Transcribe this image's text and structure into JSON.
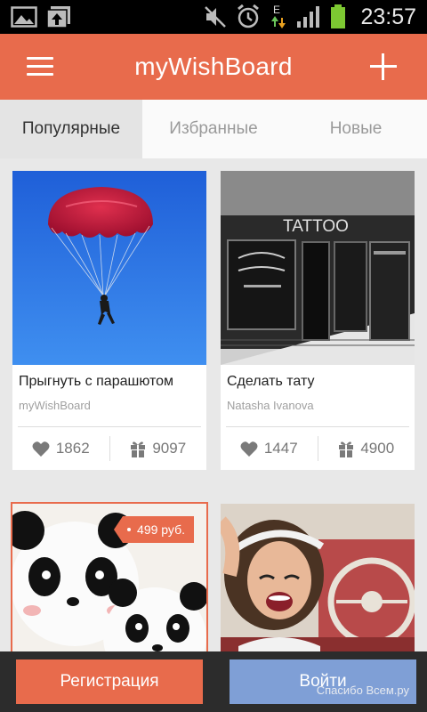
{
  "status_bar": {
    "time": "23:57",
    "network_label": "E",
    "icons": [
      "gallery-icon",
      "media-upload-icon",
      "mute-icon",
      "alarm-icon",
      "data-arrows-icon",
      "signal-icon",
      "battery-icon"
    ]
  },
  "app_bar": {
    "title": "myWishBoard",
    "menu_icon": "hamburger-menu-icon",
    "add_icon": "plus-icon",
    "background": "#e86b4c"
  },
  "tabs": [
    {
      "label": "Популярные",
      "active": true
    },
    {
      "label": "Избранные",
      "active": false
    },
    {
      "label": "Новые",
      "active": false
    }
  ],
  "cards": [
    {
      "title": "Прыгнуть с парашютом",
      "author": "myWishBoard",
      "likes": "1862",
      "gifts": "9097",
      "image": "parachute-photo"
    },
    {
      "title": "Сделать тату",
      "author": "Natasha Ivanova",
      "likes": "1447",
      "gifts": "4900",
      "image": "tattoo-shop-photo",
      "sign_text": "TATTOO"
    },
    {
      "title": "",
      "author": "",
      "price": "499 руб.",
      "image": "panda-plush-photo"
    },
    {
      "title": "",
      "author": "",
      "image": "woman-in-car-photo"
    }
  ],
  "bottom_bar": {
    "register_label": "Регистрация",
    "login_label": "Войти",
    "watermark": "Спасибо Всем.ру"
  },
  "colors": {
    "accent": "#e86b4c",
    "login_button": "#7f9fd6",
    "bottom_bar": "#2c2c2c"
  }
}
